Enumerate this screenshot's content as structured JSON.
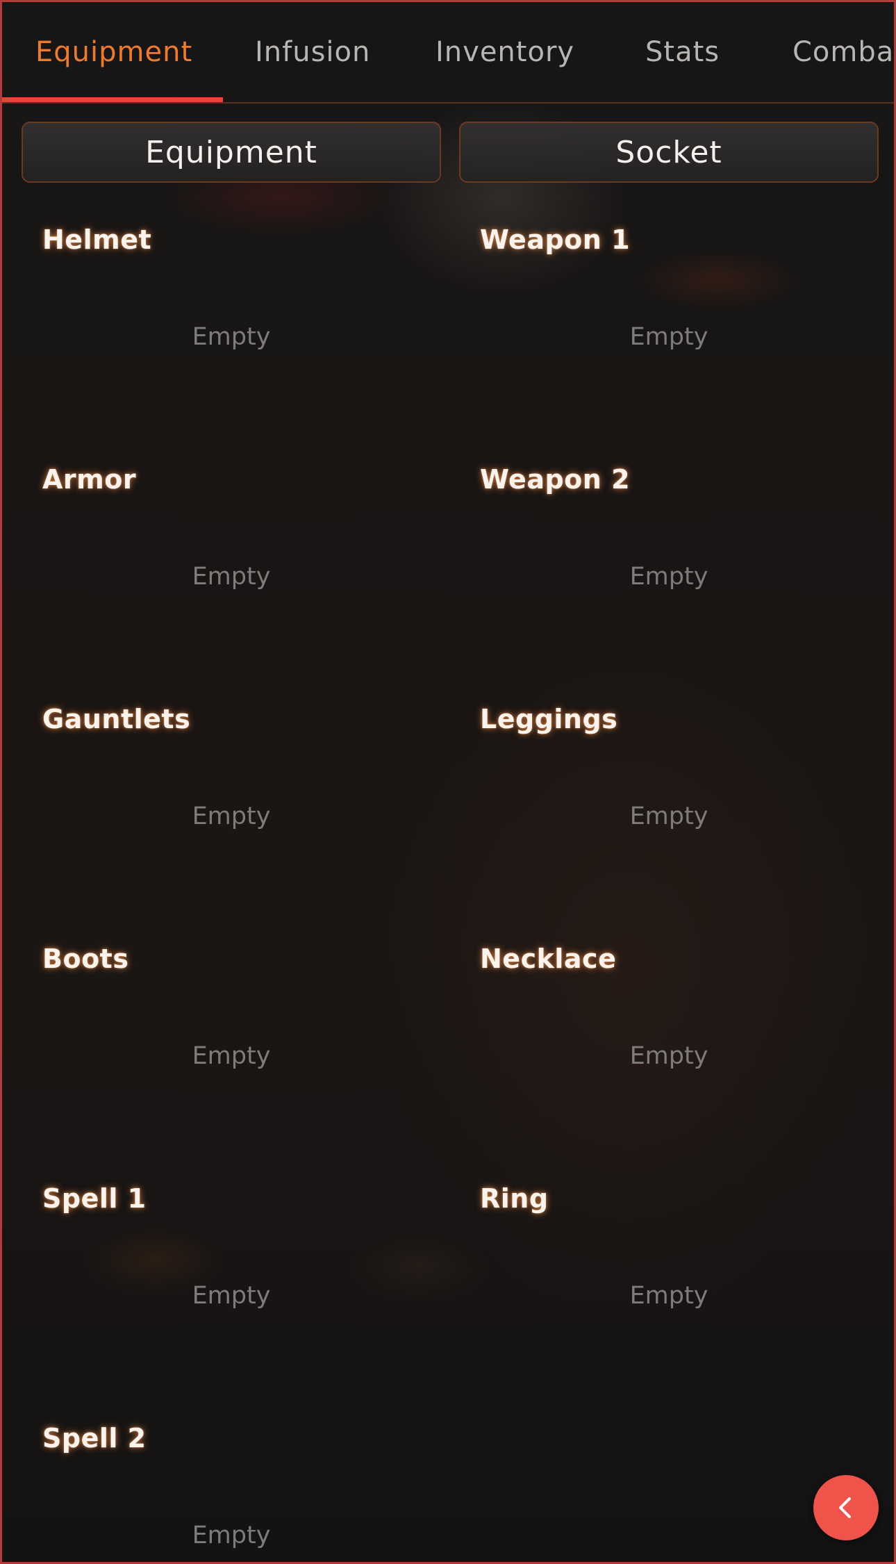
{
  "tabs": [
    {
      "label": "Equipment",
      "active": true
    },
    {
      "label": "Infusion",
      "active": false
    },
    {
      "label": "Inventory",
      "active": false
    },
    {
      "label": "Stats",
      "active": false
    },
    {
      "label": "Comba",
      "active": false
    }
  ],
  "subtabs": [
    {
      "label": "Equipment"
    },
    {
      "label": "Socket"
    }
  ],
  "slots": [
    {
      "name": "Helmet",
      "status": "Empty"
    },
    {
      "name": "Weapon 1",
      "status": "Empty"
    },
    {
      "name": "Armor",
      "status": "Empty"
    },
    {
      "name": "Weapon 2",
      "status": "Empty"
    },
    {
      "name": "Gauntlets",
      "status": "Empty"
    },
    {
      "name": "Leggings",
      "status": "Empty"
    },
    {
      "name": "Boots",
      "status": "Empty"
    },
    {
      "name": "Necklace",
      "status": "Empty"
    },
    {
      "name": "Spell 1",
      "status": "Empty"
    },
    {
      "name": "Ring",
      "status": "Empty"
    },
    {
      "name": "Spell 2",
      "status": "Empty"
    }
  ],
  "back_button": {
    "icon": "chevron-left-icon"
  },
  "colors": {
    "accent": "#f07a2a",
    "tab_indicator": "#e8443a",
    "back_button": "#f0534a",
    "frame_border": "#b53a3a"
  }
}
